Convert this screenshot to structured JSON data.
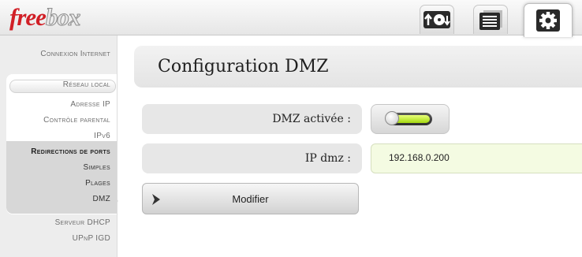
{
  "header": {
    "logo_part1": "free",
    "logo_part2": "box",
    "toolbar": [
      {
        "icon": "download-icon",
        "active": false
      },
      {
        "icon": "explorer-icon",
        "active": false
      },
      {
        "icon": "gear-icon",
        "active": true
      }
    ]
  },
  "sidebar": {
    "items": [
      {
        "label": "Connexion Internet"
      },
      {
        "label": "Réseau local"
      },
      {
        "label": "Adresse IP"
      },
      {
        "label": "Contrôle parental"
      },
      {
        "label": "IPv6"
      },
      {
        "label": "Redirections de ports"
      },
      {
        "label": "Simples"
      },
      {
        "label": "Plages"
      },
      {
        "label": "DMZ"
      },
      {
        "label": "Serveur DHCP"
      },
      {
        "label": "UPnP IGD"
      }
    ],
    "active": "Redirections de ports"
  },
  "main": {
    "title": "Configuration DMZ",
    "dmz_label": "DMZ activée :",
    "dmz_enabled": true,
    "ip_label": "IP dmz :",
    "ip_value": "192.168.0.200",
    "modify_label": "Modifier"
  },
  "colors": {
    "logo_red": "#d11f26",
    "toggle_green": "#a4d810",
    "ip_field_bg": "#f4fbe2"
  }
}
